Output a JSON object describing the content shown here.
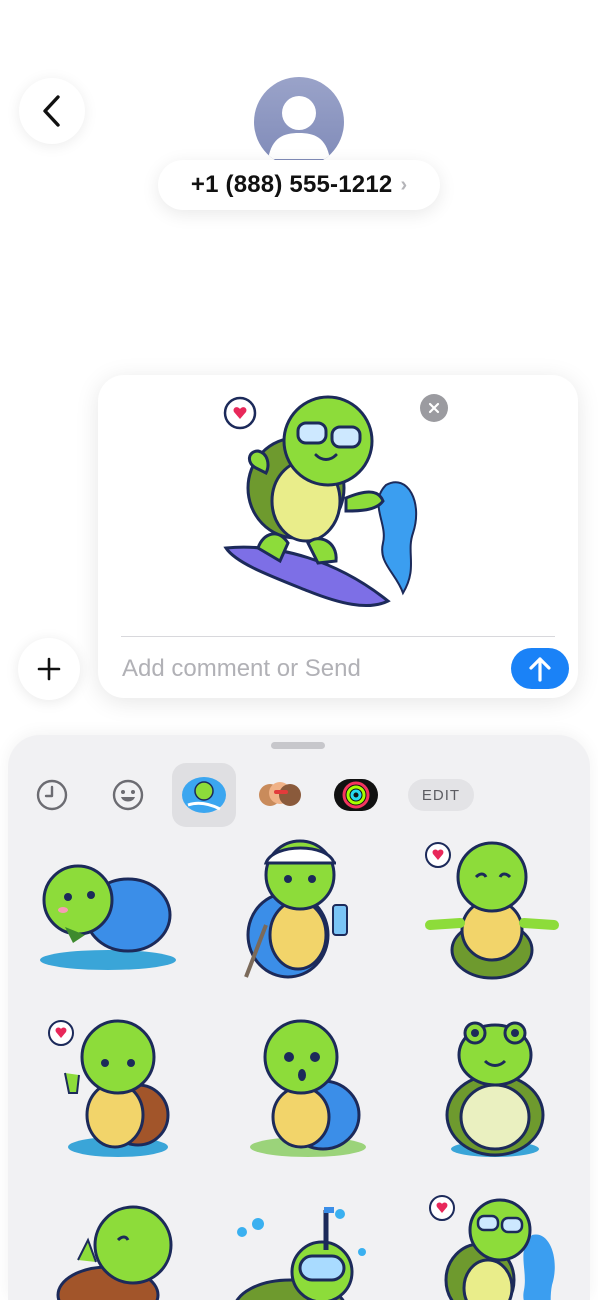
{
  "header": {
    "contact_number": "+1 (888) 555-1212",
    "chevron_glyph": "›"
  },
  "compose": {
    "input_placeholder": "Add comment or Send",
    "input_value": ""
  },
  "tray": {
    "edit_label": "EDIT",
    "tabs": [
      "recents",
      "emoji",
      "turtle-sticker-pack",
      "memoji",
      "activity-rings"
    ],
    "selected_tab": "turtle-sticker-pack"
  },
  "stickers": [
    "turtle-eating-leaf",
    "turtle-hiker-with-cap",
    "turtle-meditating",
    "turtle-peace-sign",
    "turtle-surprised",
    "turtle-frog-face",
    "turtle-yawning",
    "turtle-snorkeling",
    "turtle-surfing"
  ],
  "colors": {
    "accent_blue": "#1a82f7",
    "turtle_green": "#8ddc3a",
    "shell_blue": "#3b8ee8",
    "tray_bg": "#f1f1f3"
  }
}
